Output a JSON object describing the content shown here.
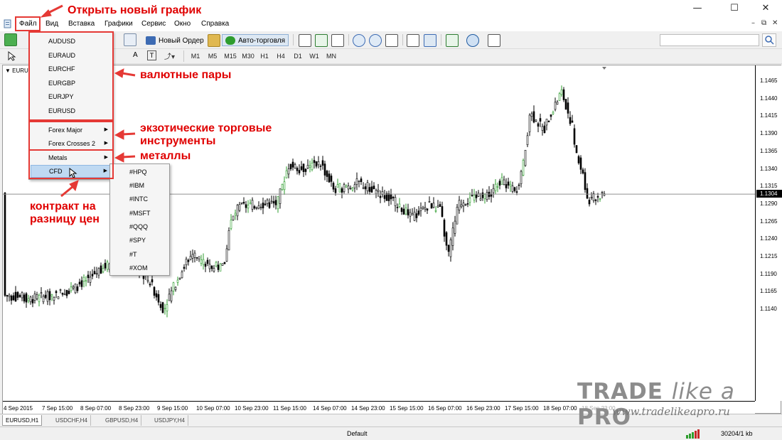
{
  "menubar": {
    "items": [
      "Файл",
      "Вид",
      "Вставка",
      "Графики",
      "Сервис",
      "Окно",
      "Справка"
    ]
  },
  "toolbar": {
    "new_order_label": "Новый Ордер",
    "autotrading_label": "Авто-торговля",
    "periods": [
      "M1",
      "M5",
      "M15",
      "M30",
      "H1",
      "H4",
      "D1",
      "W1",
      "MN"
    ]
  },
  "symbols_menu": {
    "currency_pairs": [
      "AUDUSD",
      "EURAUD",
      "EURCHF",
      "EURGBP",
      "EURJPY",
      "EURUSD"
    ],
    "groups": [
      "Forex Major",
      "Forex Crosses 2",
      "Metals",
      "CFD"
    ]
  },
  "cfd_submenu": {
    "items": [
      "#HPQ",
      "#IBM",
      "#INTC",
      "#MSFT",
      "#QQQ",
      "#SPY",
      "#T",
      "#XOM"
    ]
  },
  "chart": {
    "symbol_label": "EURU",
    "price_ticks": [
      "1.1465",
      "1.1440",
      "1.1415",
      "1.1390",
      "1.1365",
      "1.1340",
      "1.1315",
      "1.1290",
      "1.1265",
      "1.1240",
      "1.1215",
      "1.1190",
      "1.1165",
      "1.1140"
    ],
    "current_price": "1.1304",
    "time_ticks": [
      "4 Sep 2015",
      "7 Sep 15:00",
      "8 Sep 07:00",
      "8 Sep 23:00",
      "9 Sep 15:00",
      "10 Sep 07:00",
      "10 Sep 23:00",
      "11 Sep 15:00",
      "14 Sep 07:00",
      "14 Sep 23:00",
      "15 Sep 15:00",
      "16 Sep 07:00",
      "16 Sep 23:00",
      "17 Sep 15:00",
      "18 Sep 07:00",
      "18 Sep 23:00"
    ]
  },
  "chart_tabs": [
    "EURUSD,H1",
    "USDCHF,H4",
    "GBPUSD,H4",
    "USDJPY,H4"
  ],
  "statusbar": {
    "profile": "Default",
    "traffic": "30204/1 kb"
  },
  "annotations": {
    "open_chart": "Открыть новый график",
    "currency_pairs": "валютные пары",
    "exotic_line1": "экзотические торговые",
    "exotic_line2": "инструменты",
    "metals": "металлы",
    "cfd_line1": "контракт на",
    "cfd_line2": "разницу цен"
  },
  "watermark": {
    "brand_prefix": "TRADE ",
    "brand_italic": "like a",
    "brand_suffix": " PRO",
    "url": "www.tradelikeapro.ru"
  },
  "colors": {
    "annotation_red": "#e53935",
    "menu_highlight": "#bfd9f2",
    "bull_candle": "#2e9d2e",
    "bear_candle": "#000000"
  }
}
